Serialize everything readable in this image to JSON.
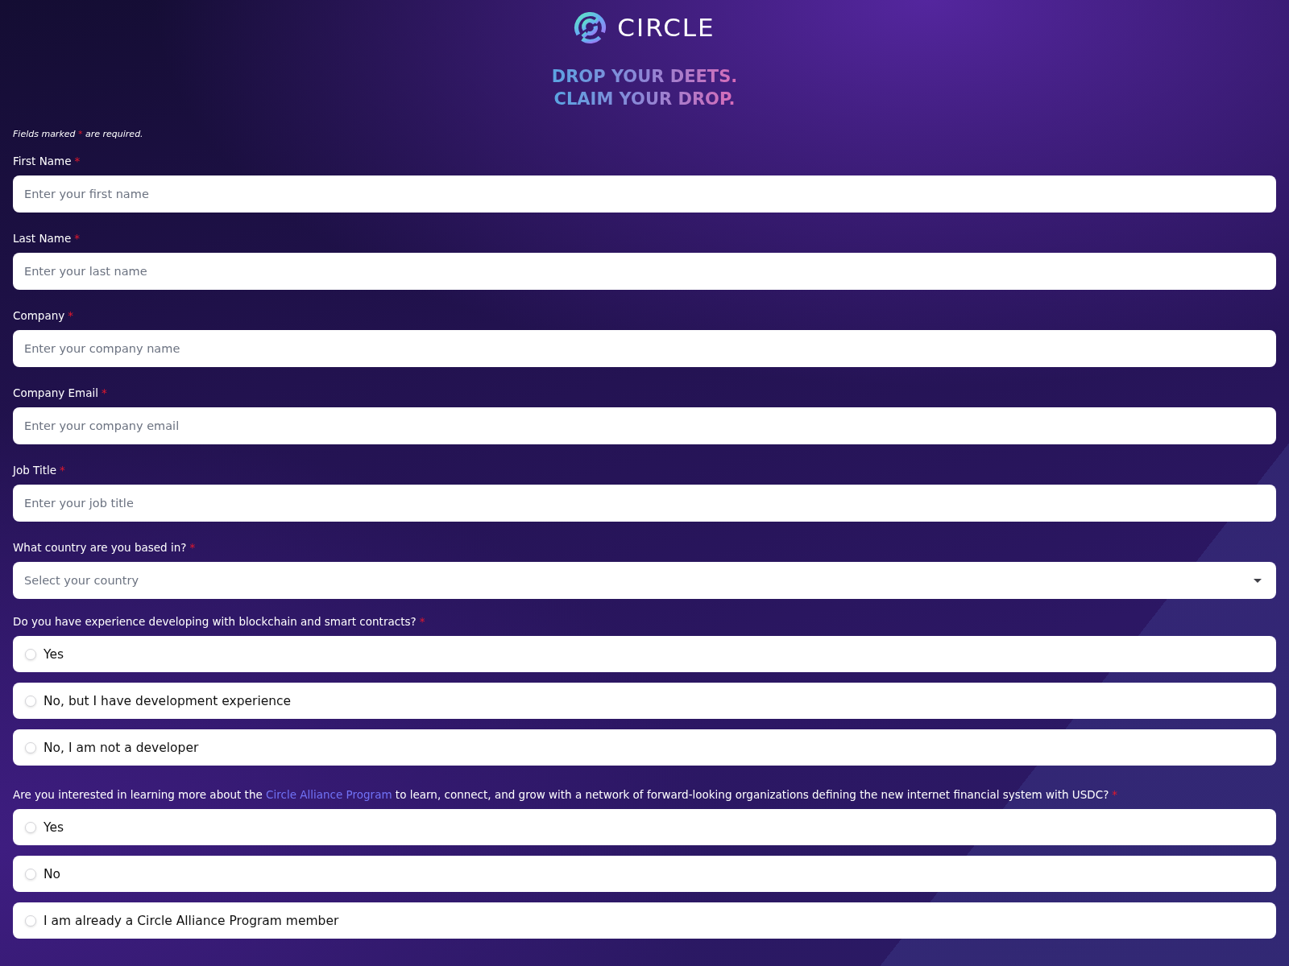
{
  "header": {
    "wordmark": "CIRCLE",
    "headline": [
      "DROP YOUR DEETS.",
      "CLAIM YOUR DROP."
    ]
  },
  "form": {
    "note": {
      "before": "Fields marked",
      "mark": "*",
      "after": "are required."
    },
    "fields": [
      {
        "kind": "text",
        "label": "First Name",
        "required_mark": "*",
        "placeholder": "Enter your first name"
      },
      {
        "kind": "text",
        "label": "Last Name",
        "required_mark": "*",
        "placeholder": "Enter your last name"
      },
      {
        "kind": "text",
        "label": "Company",
        "required_mark": "*",
        "placeholder": "Enter your company name"
      },
      {
        "kind": "text",
        "label": "Company Email",
        "required_mark": "*",
        "placeholder": "Enter your company email"
      },
      {
        "kind": "text",
        "label": "Job Title",
        "required_mark": "*",
        "placeholder": "Enter your job title"
      },
      {
        "kind": "select",
        "label": "What country are you based in?",
        "required_mark": "*",
        "placeholder": "Select your country"
      }
    ],
    "questions": [
      {
        "label_before": "Do you have experience developing with blockchain and smart contracts?",
        "required_mark": "*",
        "options": [
          {
            "label": "Yes",
            "selected": false
          },
          {
            "label": "No, but I have development experience",
            "selected": false
          },
          {
            "label": "No, I am not a developer",
            "selected": false
          }
        ]
      },
      {
        "label_before": "Are you interested in learning more about the",
        "link": "Circle Alliance Program",
        "label_after": "to learn, connect, and grow with a network of forward-looking organizations defining the new internet financial system with USDC?",
        "required_mark": "*",
        "options": [
          {
            "label": "Yes",
            "selected": false
          },
          {
            "label": "No",
            "selected": false
          },
          {
            "label": "I am already a Circle Alliance Program member",
            "selected": false
          }
        ]
      }
    ]
  }
}
